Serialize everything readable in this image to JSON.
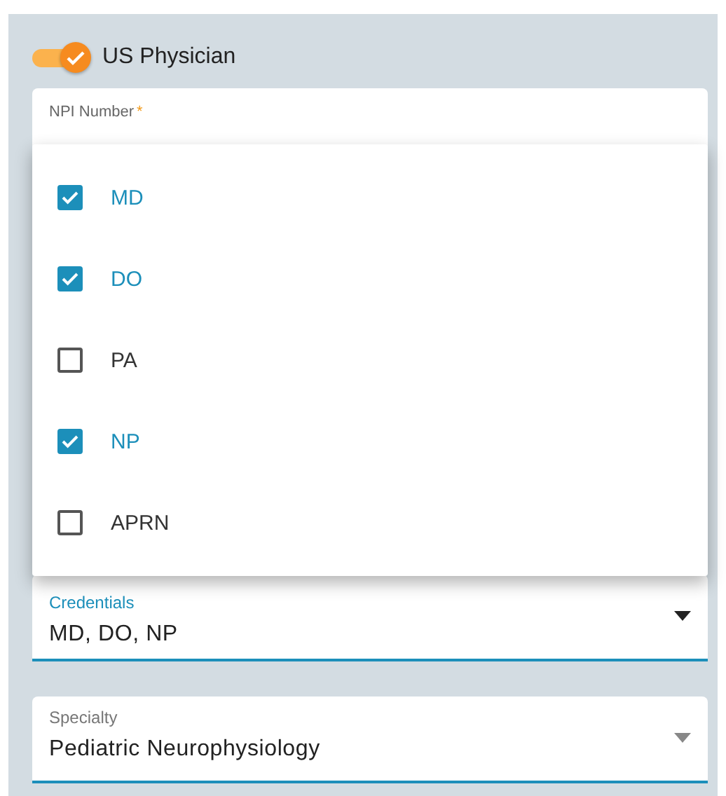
{
  "toggle": {
    "label": "US Physician",
    "on": true
  },
  "npi_field": {
    "label": "NPI Number",
    "required_mark": "*"
  },
  "credentials_menu": {
    "options": [
      {
        "label": "MD",
        "checked": true
      },
      {
        "label": "DO",
        "checked": true
      },
      {
        "label": "PA",
        "checked": false
      },
      {
        "label": "NP",
        "checked": true
      },
      {
        "label": "APRN",
        "checked": false
      }
    ]
  },
  "fields": [
    {
      "label": "Credentials",
      "value": "MD, DO, NP",
      "focused": true
    },
    {
      "label": "Specialty",
      "value": "Pediatric Neurophysiology",
      "focused": false
    }
  ]
}
